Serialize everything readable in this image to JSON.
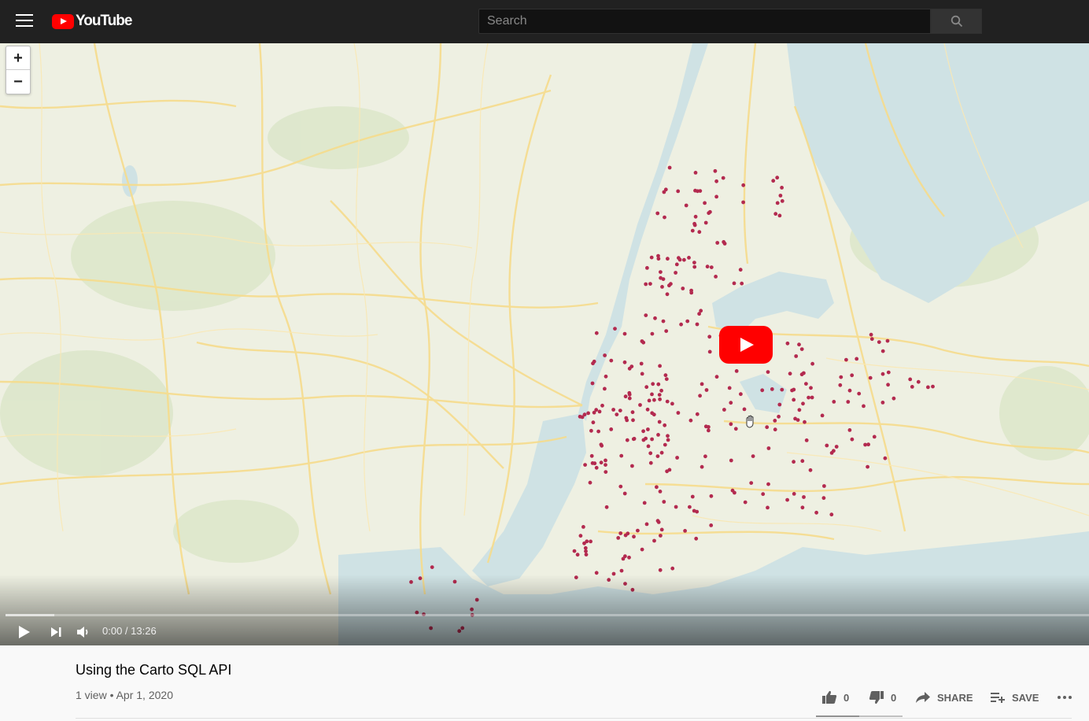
{
  "header": {
    "logo_text": "YouTube",
    "search_placeholder": "Search"
  },
  "player": {
    "map_zoom_in": "+",
    "map_zoom_out": "−",
    "time_display": "0:00 / 13:26",
    "progress_loaded_fraction": 0.045
  },
  "video": {
    "title": "Using the Carto SQL API",
    "meta": "1 view • Apr 1, 2020"
  },
  "actions": {
    "like_count": "0",
    "dislike_count": "0",
    "share_label": "SHARE",
    "save_label": "SAVE"
  },
  "colors": {
    "brand_red": "#ff0000",
    "header_bg": "#212121",
    "point_color": "#b32a4f"
  }
}
